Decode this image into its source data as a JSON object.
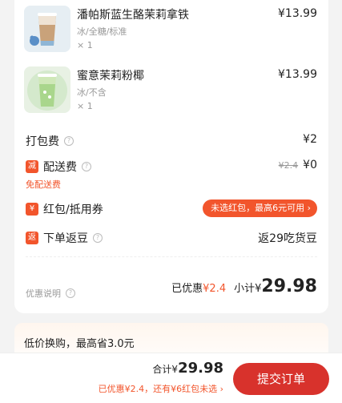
{
  "items": [
    {
      "name": "潘帕斯蓝生酪茉莉拿铁",
      "spec": "冰/全糖/标准",
      "qty": "× 1",
      "price": "¥13.99",
      "thumb_icon": "iced-latte-cup-icon"
    },
    {
      "name": "蜜意茉莉粉椰",
      "spec": "冰/不含",
      "qty": "× 1",
      "price": "¥13.99",
      "thumb_icon": "green-iced-drink-cup-icon"
    }
  ],
  "packing": {
    "label": "打包费",
    "value": "¥2"
  },
  "delivery": {
    "badge": "减",
    "label": "配送费",
    "original": "¥2.4",
    "value": "¥0",
    "sublabel": "免配送费"
  },
  "coupon": {
    "badge": "¥",
    "label": "红包/抵用券",
    "pill": "未选红包，最高6元可用 ›"
  },
  "cashback": {
    "badge": "返",
    "label": "下单返豆",
    "value": "返29吃货豆"
  },
  "summary": {
    "discount_info_label": "优惠说明",
    "discounted_label": "已优惠",
    "discounted_value": "¥2.4",
    "subtotal_label": "小计",
    "subtotal_currency": "¥",
    "subtotal_value": "29.98"
  },
  "promo": {
    "text": "低价换购，最高省3.0元"
  },
  "footer": {
    "total_label": "合计",
    "total_currency": "¥",
    "total_value": "29.98",
    "discount_line": "已优惠¥2.4，还有¥6红包未选 ›",
    "submit_label": "提交订单"
  },
  "colors": {
    "accent": "#f2552c",
    "submit": "#d8322c"
  }
}
